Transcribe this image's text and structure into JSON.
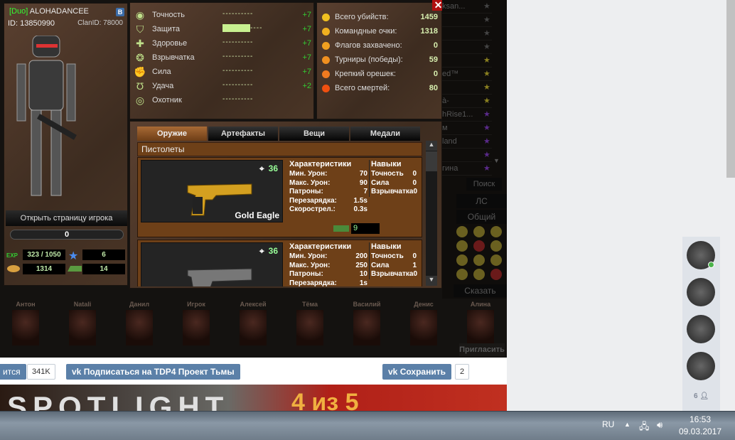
{
  "player": {
    "clan_tag": "[Duo]",
    "name": "ALOHADANCEE",
    "id": "ID: 13850990",
    "clan_id": "ClanID: 78000",
    "open_page": "Открыть страницу игрока",
    "progress": "0",
    "exp_label": "EXP",
    "exp": "323 / 1050",
    "stars": "6",
    "coins": "1314",
    "gold": "14"
  },
  "attributes": [
    {
      "label": "Точность",
      "bonus": "+7",
      "level": 0,
      "icon": "eye-icon"
    },
    {
      "label": "Защита",
      "bonus": "+7",
      "level": 6,
      "icon": "shield-icon"
    },
    {
      "label": "Здоровье",
      "bonus": "+7",
      "level": 0,
      "icon": "cross-icon"
    },
    {
      "label": "Взрывчатка",
      "bonus": "+7",
      "level": 0,
      "icon": "grenade-icon"
    },
    {
      "label": "Сила",
      "bonus": "+7",
      "level": 0,
      "icon": "fist-icon"
    },
    {
      "label": "Удача",
      "bonus": "+2",
      "level": 0,
      "icon": "horseshoe-icon"
    },
    {
      "label": "Охотник",
      "bonus": "",
      "level": 0,
      "icon": "hunter-icon"
    }
  ],
  "kill_stats": [
    {
      "label": "Всего убийств:",
      "value": "1459",
      "color": "#f0c020"
    },
    {
      "label": "Командные очки:",
      "value": "1318",
      "color": "#f0b020"
    },
    {
      "label": "Флагов захвачено:",
      "value": "0",
      "color": "#f0a020"
    },
    {
      "label": "Турниры (победы):",
      "value": "59",
      "color": "#f09020"
    },
    {
      "label": "Крепкий орешек:",
      "value": "0",
      "color": "#f07a20"
    },
    {
      "label": "Всего смертей:",
      "value": "80",
      "color": "#f05010"
    }
  ],
  "tabs": [
    "Оружие",
    "Артефакты",
    "Вещи",
    "Медали"
  ],
  "category": "Пистолеты",
  "weapons": [
    {
      "name": "Gold Eagle",
      "level": "36",
      "chars_title": "Характеристики",
      "chars": [
        [
          "Мин. Урон:",
          "70"
        ],
        [
          "Макс. Урон:",
          "90"
        ],
        [
          "Патроны:",
          "7"
        ],
        [
          "Перезарядка:",
          "1.5s"
        ],
        [
          "Скорострел.:",
          "0.3s"
        ]
      ],
      "skills_title": "Навыки",
      "skills": [
        [
          "Точность",
          "0"
        ],
        [
          "Сила",
          "0"
        ],
        [
          "Взрывчатка",
          "0"
        ]
      ],
      "price": "9"
    },
    {
      "name": "",
      "level": "36",
      "chars_title": "Характеристики",
      "chars": [
        [
          "Мин. Урон:",
          "200"
        ],
        [
          "Макс. Урон:",
          "250"
        ],
        [
          "Патроны:",
          "10"
        ],
        [
          "Перезарядка:",
          "1s"
        ]
      ],
      "skills_title": "Навыки",
      "skills": [
        [
          "Точность",
          "0"
        ],
        [
          "Сила",
          "1"
        ],
        [
          "Взрывчатка",
          "0"
        ]
      ]
    }
  ],
  "chat": {
    "names": [
      "ksan...",
      "",
      "",
      "",
      "",
      "ed™",
      "",
      "à-",
      "hRise1...",
      "м",
      "land",
      "",
      "гина"
    ],
    "search": "Поиск",
    "pm": "ЛС",
    "general": "Общий",
    "say": "Сказать"
  },
  "friends": [
    "Антон",
    "Natali",
    "Данил",
    "Игрок",
    "Алексей",
    "Тёма",
    "Василий",
    "Денис",
    "Алина"
  ],
  "invite": "Пригласить",
  "vk": {
    "share_partial": "ится",
    "share_count": "341K",
    "subscribe": "Подписаться на TDP4 Проект Тьмы",
    "save": "Сохранить",
    "save_count": "2",
    "brand": "#5b80a8"
  },
  "banner": {
    "left": "SPOTLIGHT",
    "right": "4 из 5"
  },
  "sidebar": {
    "friends_count": "6"
  },
  "taskbar": {
    "lang": "RU",
    "time": "16:53",
    "date": "09.03.2017"
  }
}
